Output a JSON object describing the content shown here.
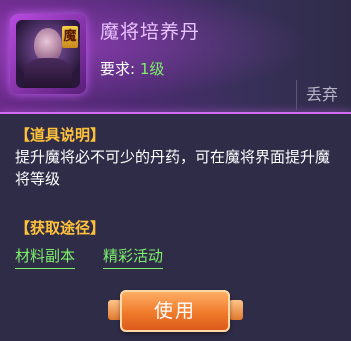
{
  "item": {
    "name": "魔将培养丹",
    "badge": "魔",
    "requirement_label": "要求: ",
    "requirement_level": "1级"
  },
  "actions": {
    "discard_label": "丢弃",
    "use_label": "使用"
  },
  "description": {
    "heading": "【道具说明】",
    "text": "提升魔将必不可少的丹药，可在魔将界面提升魔将等级"
  },
  "sources": {
    "heading": "【获取途径】",
    "links": [
      "材料副本",
      "精彩活动"
    ]
  },
  "colors": {
    "accent_purple": "#d36cf5",
    "heading_gold": "#ffc33a",
    "link_green": "#7cf06a",
    "button_orange": "#f07a2a"
  }
}
